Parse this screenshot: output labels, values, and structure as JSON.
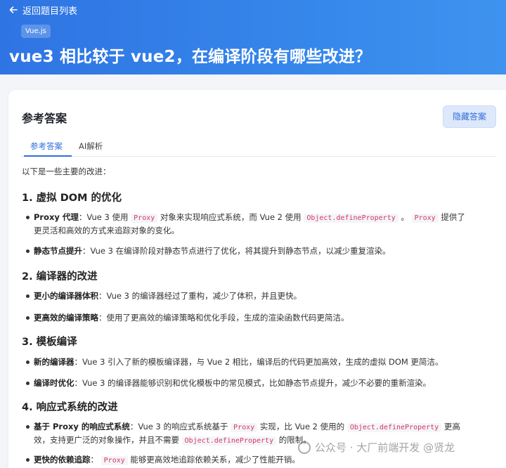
{
  "header": {
    "back_label": "返回题目列表",
    "badge": "Vue.js",
    "title": "vue3 相比较于 vue2，在编译阶段有哪些改进？"
  },
  "card": {
    "title": "参考答案",
    "hide_button": "隐藏答案",
    "tabs": [
      {
        "label": "参考答案",
        "active": true
      },
      {
        "label": "AI解析",
        "active": false
      }
    ]
  },
  "answer": {
    "intro": "以下是一些主要的改进：",
    "sections": [
      {
        "heading": "1. 虚拟 DOM 的优化",
        "items": [
          {
            "bold": "Proxy 代理",
            "line1_pre": "：Vue 3 使用",
            "code1": "Proxy",
            "line1_mid": "对象来实现响应式系统，而 Vue 2 使用",
            "code2": "Object.defineProperty",
            "line1_mid2": "。",
            "code3": "Proxy",
            "line1_post": "提供了",
            "line2": "更灵活和高效的方式来追踪对象的变化。"
          },
          {
            "bold": "静态节点提升",
            "text": "：Vue 3 在编译阶段对静态节点进行了优化，将其提升到静态节点，以减少重复渲染。"
          }
        ]
      },
      {
        "heading": "2. 编译器的改进",
        "items": [
          {
            "bold": "更小的编译器体积",
            "text": "：Vue 3 的编译器经过了重构，减少了体积，并且更快。"
          },
          {
            "bold": "更高效的编译策略",
            "text": "：使用了更高效的编译策略和优化手段，生成的渲染函数代码更简洁。"
          }
        ]
      },
      {
        "heading": "3. 模板编译",
        "items": [
          {
            "bold": "新的编译器",
            "text": "：Vue 3 引入了新的模板编译器，与 Vue 2 相比，编译后的代码更加高效，生成的虚拟 DOM 更简洁。"
          },
          {
            "bold": "编译时优化",
            "text": "：Vue 3 的编译器能够识别和优化模板中的常见模式，比如静态节点提升，减少不必要的重新渲染。"
          }
        ]
      },
      {
        "heading": "4. 响应式系统的改进",
        "items": [
          {
            "bold": "基于 Proxy 的响应式系统",
            "line1_pre": "：Vue 3 的响应式系统基于",
            "code1": "Proxy",
            "line1_mid": "实现，比 Vue 2 使用的",
            "code2": "Object.defineProperty",
            "line1_post": "更高",
            "line2_pre": "效，支持更广泛的对象操作，并且不需要",
            "code3": "Object.defineProperty",
            "line2_post": "的限制。"
          },
          {
            "bold": "更快的依赖追踪",
            "line1_pre": "：",
            "code1": "Proxy",
            "line1_post": "能够更高效地追踪依赖关系，减少了性能开销。"
          }
        ]
      }
    ]
  },
  "watermark": "公众号 · 大厂前端开发 @贤龙"
}
